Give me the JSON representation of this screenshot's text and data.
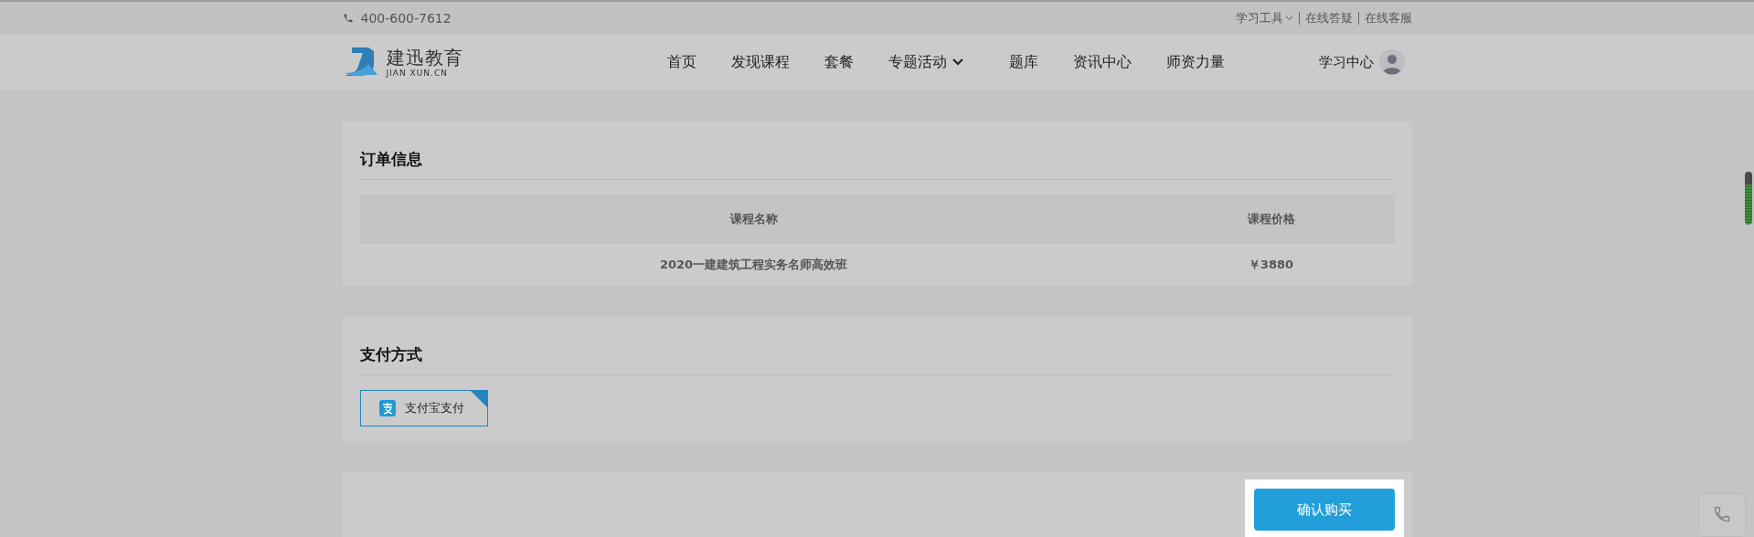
{
  "top_bar": {
    "phone": "400-600-7612",
    "links": [
      {
        "label": "学习工具",
        "dropdown": true
      },
      {
        "label": "在线答疑",
        "dropdown": false
      },
      {
        "label": "在线客服",
        "dropdown": false
      }
    ]
  },
  "nav": {
    "logo": {
      "name": "建迅教育",
      "subtitle": "JIAN XUN.CN"
    },
    "items": [
      {
        "label": "首页",
        "dropdown": false
      },
      {
        "label": "发现课程",
        "dropdown": false
      },
      {
        "label": "套餐",
        "dropdown": false
      },
      {
        "label": "专题活动",
        "dropdown": true
      },
      {
        "label": "题库",
        "dropdown": false
      },
      {
        "label": "资讯中心",
        "dropdown": false
      },
      {
        "label": "师资力量",
        "dropdown": false
      }
    ],
    "user": {
      "label": "学习中心"
    }
  },
  "order": {
    "title": "订单信息",
    "columns": [
      "课程名称",
      "课程价格"
    ],
    "rows": [
      {
        "cells": [
          "2020一建建筑工程实务名师高效班",
          "￥3880"
        ]
      }
    ]
  },
  "payment": {
    "title": "支付方式",
    "options": [
      {
        "label": "支付宝支付",
        "selected": true
      }
    ]
  },
  "confirm_button": {
    "label": "确认购买"
  }
}
